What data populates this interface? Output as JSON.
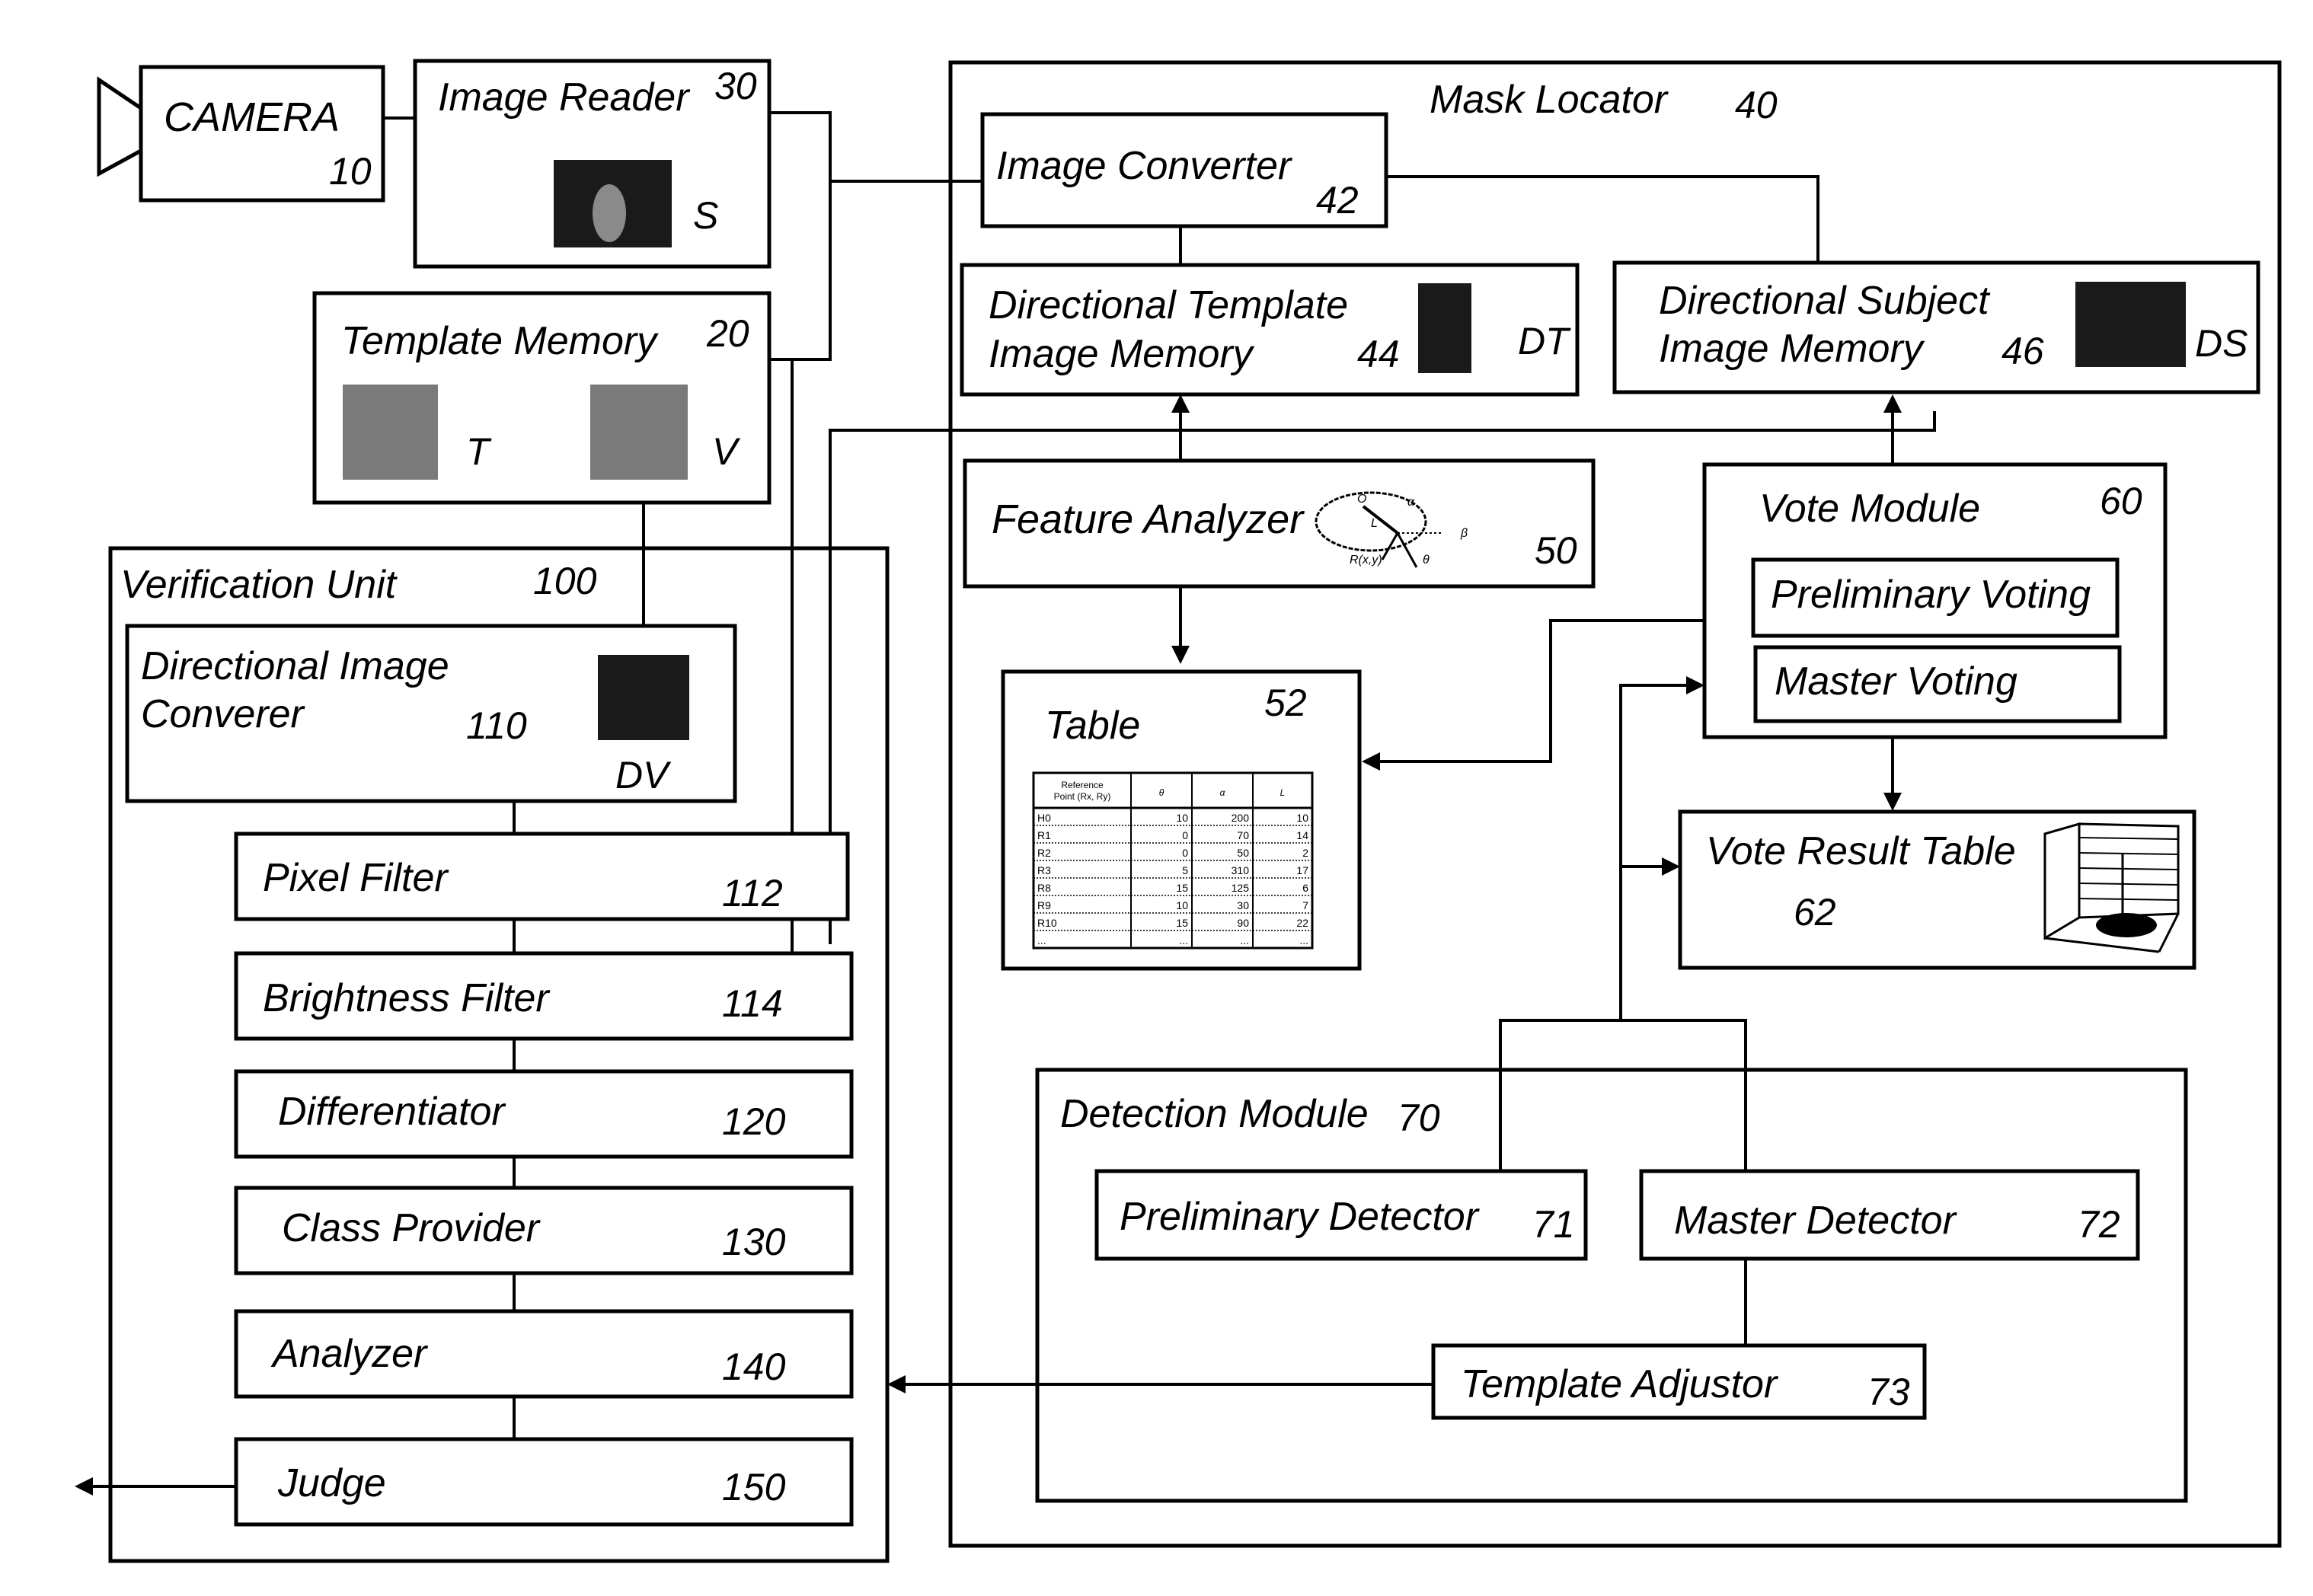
{
  "camera": {
    "label": "CAMERA",
    "ref": "10"
  },
  "image_reader": {
    "label": "Image Reader",
    "ref": "30",
    "image_label": "S"
  },
  "template_memory": {
    "label": "Template Memory",
    "ref": "20",
    "image_t_label": "T",
    "image_v_label": "V"
  },
  "mask_locator": {
    "label": "Mask Locator",
    "ref": "40"
  },
  "image_converter": {
    "label": "Image Converter",
    "ref": "42"
  },
  "directional_template_memory": {
    "line1": "Directional Template",
    "line2": "Image Memory",
    "ref": "44",
    "image_label": "DT"
  },
  "directional_subject_memory": {
    "line1": "Directional Subject",
    "line2": "Image Memory",
    "ref": "46",
    "image_label": "DS"
  },
  "feature_analyzer": {
    "label": "Feature Analyzer",
    "ref": "50",
    "diagram_labels": {
      "origin": "O",
      "alpha": "α",
      "length": "L",
      "beta": "β",
      "ref_point": "R(x,y)",
      "theta": "θ"
    }
  },
  "table": {
    "label": "Table",
    "ref": "52",
    "headers": [
      "Reference Point (Rx, Ry)",
      "θ",
      "α",
      "L"
    ],
    "rows": [
      [
        "H0",
        "10",
        "200",
        "10"
      ],
      [
        "R1",
        "0",
        "70",
        "14"
      ],
      [
        "R2",
        "0",
        "50",
        "2"
      ],
      [
        "R3",
        "5",
        "310",
        "17"
      ],
      [
        "R8",
        "15",
        "125",
        "6"
      ],
      [
        "R9",
        "10",
        "30",
        "7"
      ],
      [
        "R10",
        "15",
        "90",
        "22"
      ],
      [
        "...",
        "...",
        "...",
        "..."
      ]
    ]
  },
  "vote_module": {
    "label": "Vote Module",
    "ref": "60",
    "preliminary": "Preliminary Voting",
    "master": "Master Voting"
  },
  "vote_result_table": {
    "label": "Vote Result Table",
    "ref": "62"
  },
  "detection_module": {
    "label": "Detection Module",
    "ref": "70"
  },
  "preliminary_detector": {
    "label": "Preliminary Detector",
    "ref": "71"
  },
  "master_detector": {
    "label": "Master Detector",
    "ref": "72"
  },
  "template_adjustor": {
    "label": "Template Adjustor",
    "ref": "73"
  },
  "verification_unit": {
    "label": "Verification Unit",
    "ref": "100"
  },
  "directional_image_converter": {
    "line1": "Directional Image",
    "line2": "Converer",
    "ref": "110",
    "image_label": "DV"
  },
  "pipeline": [
    {
      "label": "Pixel Filter",
      "ref": "112"
    },
    {
      "label": "Brightness Filter",
      "ref": "114"
    },
    {
      "label": "Differentiator",
      "ref": "120"
    },
    {
      "label": "Class Provider",
      "ref": "130"
    },
    {
      "label": "Analyzer",
      "ref": "140"
    },
    {
      "label": "Judge",
      "ref": "150"
    }
  ]
}
